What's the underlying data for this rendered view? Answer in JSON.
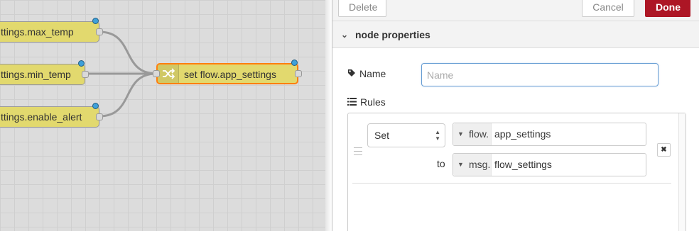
{
  "canvas": {
    "nodes": [
      {
        "label": "ttings.max_temp"
      },
      {
        "label": "ttings.min_temp"
      },
      {
        "label": "ttings.enable_alert"
      },
      {
        "label": "set flow.app_settings"
      }
    ],
    "colors": {
      "node_fill": "#e2d96e",
      "selected_border": "#ff7f0e",
      "status_dot": "#3ea0d9",
      "wire": "#999999"
    }
  },
  "toolbar": {
    "delete_label": "Delete",
    "cancel_label": "Cancel",
    "done_label": "Done",
    "done_color": "#ad1625"
  },
  "section": {
    "title": "node properties",
    "chevron_icon": "chevron-down-icon"
  },
  "name_field": {
    "label": "Name",
    "icon": "tag-icon",
    "value": "",
    "placeholder": "Name"
  },
  "rules": {
    "label": "Rules",
    "icon": "list-icon",
    "items": [
      {
        "action": "Set",
        "target_type": "flow.",
        "target_value": "app_settings",
        "to_label": "to",
        "source_type": "msg.",
        "source_value": "flow_settings",
        "remove_glyph": "✖"
      }
    ]
  }
}
